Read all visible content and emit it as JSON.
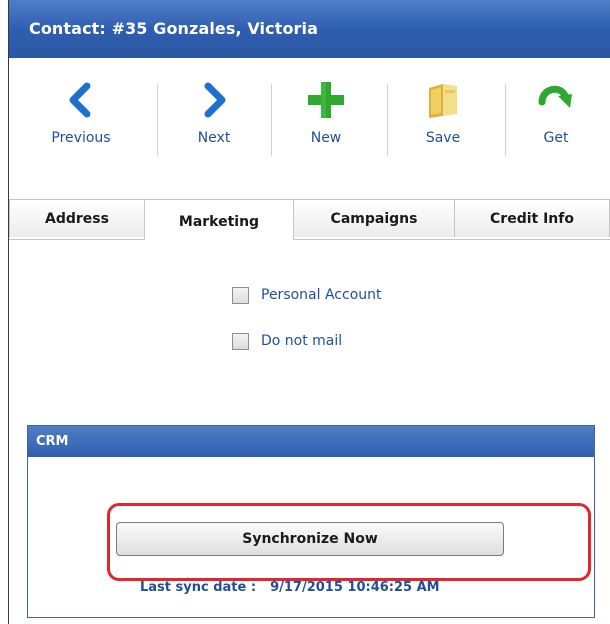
{
  "window": {
    "title": "Contact: #35  Gonzales, Victoria"
  },
  "toolbar": {
    "buttons": [
      {
        "label": "Previous",
        "icon": "chevron-left-icon",
        "color": "#1f6fd1"
      },
      {
        "label": "Next",
        "icon": "chevron-right-icon",
        "color": "#1f6fd1"
      },
      {
        "label": "New",
        "icon": "plus-icon",
        "color": "#2ea82e"
      },
      {
        "label": "Save",
        "icon": "folder-save-icon",
        "color": "#e8c84a"
      },
      {
        "label": "Get",
        "icon": "refresh-arrow-icon",
        "color": "#2ea82e"
      }
    ]
  },
  "tabs": [
    {
      "label": "Address",
      "active": false
    },
    {
      "label": "Marketing",
      "active": true
    },
    {
      "label": "Campaigns",
      "active": false
    },
    {
      "label": "Credit Info",
      "active": false
    }
  ],
  "marketing": {
    "options": [
      {
        "label": "Personal Account",
        "checked": false
      },
      {
        "label": "Do not mail",
        "checked": false
      }
    ]
  },
  "crm": {
    "header": "CRM",
    "sync_button": "Synchronize Now",
    "last_sync_label": "Last sync date :",
    "last_sync_value": "9/17/2015 10:46:25 AM"
  },
  "colors": {
    "title_bar": "#2f5fb0",
    "link_text": "#1f4f9c",
    "highlight": "#e3262b"
  }
}
